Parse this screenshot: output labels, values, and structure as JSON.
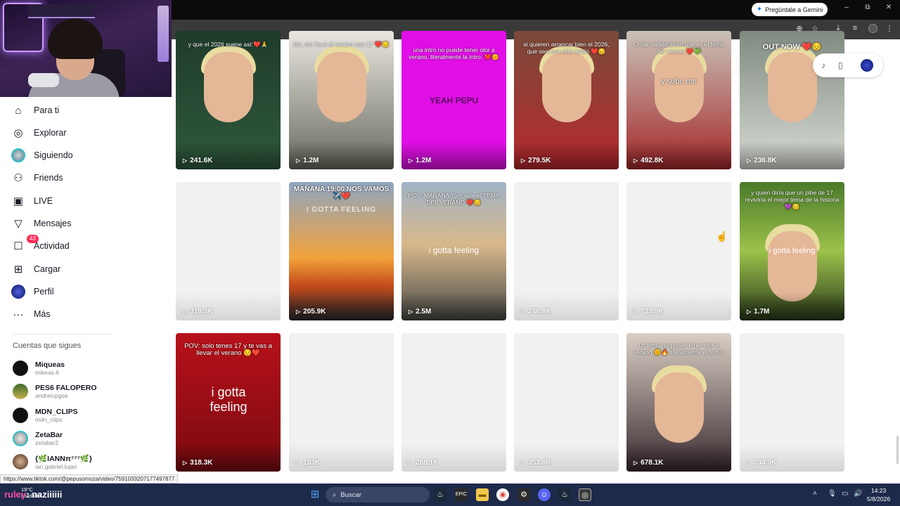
{
  "browser": {
    "gemini_button": "Pregúntale a Gemini",
    "window_controls": [
      "–",
      "⧉",
      "✕"
    ]
  },
  "stream_overlay": {
    "username_prefix": "ruley",
    "username_text": ": naziiiiii"
  },
  "nav": {
    "items": [
      {
        "label": "Para ti",
        "icon": "home-icon"
      },
      {
        "label": "Explorar",
        "icon": "compass-icon"
      },
      {
        "label": "Siguiendo",
        "icon": "avatar"
      },
      {
        "label": "Friends",
        "icon": "friends-icon"
      },
      {
        "label": "LIVE",
        "icon": "live-icon"
      },
      {
        "label": "Mensajes",
        "icon": "send-icon"
      },
      {
        "label": "Actividad",
        "icon": "inbox-icon",
        "badge": "43"
      },
      {
        "label": "Cargar",
        "icon": "plus-square-icon"
      },
      {
        "label": "Perfil",
        "icon": "avatar"
      },
      {
        "label": "Más",
        "icon": "more-icon"
      }
    ]
  },
  "following": {
    "title": "Cuentas que sigues",
    "accounts": [
      {
        "name": "Miqueas",
        "user": "mikeas.6"
      },
      {
        "name": "PES6 FALOPERO",
        "user": "andreicpgse"
      },
      {
        "name": "MDN_CLIPS",
        "user": "mdn_clips"
      },
      {
        "name": "ZetaBar",
        "user": "zetabar2"
      },
      {
        "name": "{🌿IANNπ⁷⁷⁷🌿}",
        "user": "ian.gabriel.lujan"
      }
    ]
  },
  "videos": {
    "row1": [
      {
        "views": "241.6K",
        "caption": "y que el 2026 suene así:❤️🙏"
      },
      {
        "views": "1.2M",
        "caption": "Ma, me llevé el verano con 17 ❤️😔"
      },
      {
        "views": "1.2M",
        "caption": "una intro no puede tener olor a verano, literalmente la intro: ❤️🌞",
        "big": "YEAH PEPU"
      },
      {
        "views": "279.5K",
        "caption": "si quieren arrancar bien el 2026, que sea con este audio ❤️😔"
      },
      {
        "views": "492.8K",
        "caption": "Omar Varela dicen que es el tema del verano ❤️💚",
        "big": "y   sube   me"
      },
      {
        "views": "236.8K",
        "caption": "OUT NOW ❤️😔"
      }
    ],
    "row2": [
      {
        "views": "318.3K",
        "caption": ""
      },
      {
        "views": "205.9K",
        "caption": "MAÑANA 19:00 NOS VAMOS ✈️❤️",
        "big": "I GOTTA FEELING"
      },
      {
        "views": "2.5M",
        "caption": "POV: MAÑANA 7pm sale el TEMA DEL VERANO ❤️😔",
        "big": "i gotta feeling"
      },
      {
        "views": "246.8K",
        "caption": ""
      },
      {
        "views": "733.9K",
        "caption": ""
      },
      {
        "views": "1.7M",
        "caption": "y quien diría que un pibe de 17 reviviría el mejor tema de la historia 💜😔",
        "big": "i gotta feeling"
      }
    ],
    "row3": [
      {
        "views": "318.3K",
        "caption": "POV: solo tenes 17 y te vas a llevar el verano 😔❤️",
        "big": "i gotta feeling"
      },
      {
        "views": "193K",
        "caption": ""
      },
      {
        "views": "288.1K",
        "caption": ""
      },
      {
        "views": "353.8K",
        "caption": ""
      },
      {
        "views": "678.1K",
        "caption": "un tema no puede tener olor a verano 🌞🔥 literalmente el tema:"
      },
      {
        "views": "244.9K",
        "caption": ""
      }
    ]
  },
  "status_url": "https://www.tiktok.com/@pepusomoza/video/7591033207177497877",
  "taskbar": {
    "weather": "19°C",
    "weather_sub": "Nublado",
    "search": "Buscar",
    "time": "14:23",
    "date": "5/8/2026"
  },
  "colors": {
    "accent": "#fe2c55",
    "taskbar": "#1e2a4a"
  }
}
